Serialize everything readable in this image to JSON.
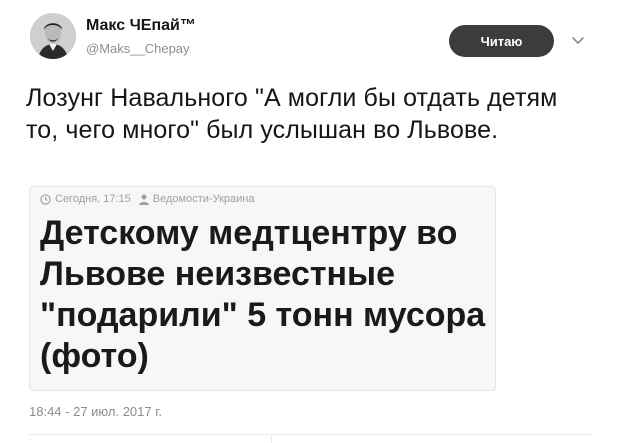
{
  "author": {
    "display_name": "Макс ЧЕпай™",
    "handle": "@Maks__Chepay"
  },
  "follow_button": {
    "label": "Читаю"
  },
  "tweet": {
    "text": "Лозунг Навального \"А могли бы отдать детям то, чего много\" был услышан во Львове."
  },
  "card": {
    "time": "Сегодня, 17:15",
    "source": "Ведомости-Украина",
    "headline": "Детскому медтцентру во Львове неизвестные \"подарили\" 5 тонн мусора (фото)"
  },
  "timestamp": "18:44 - 27 июл. 2017 г.",
  "icons": [
    "avatar-photo",
    "chevron-down-icon",
    "clock-icon",
    "user-icon"
  ]
}
